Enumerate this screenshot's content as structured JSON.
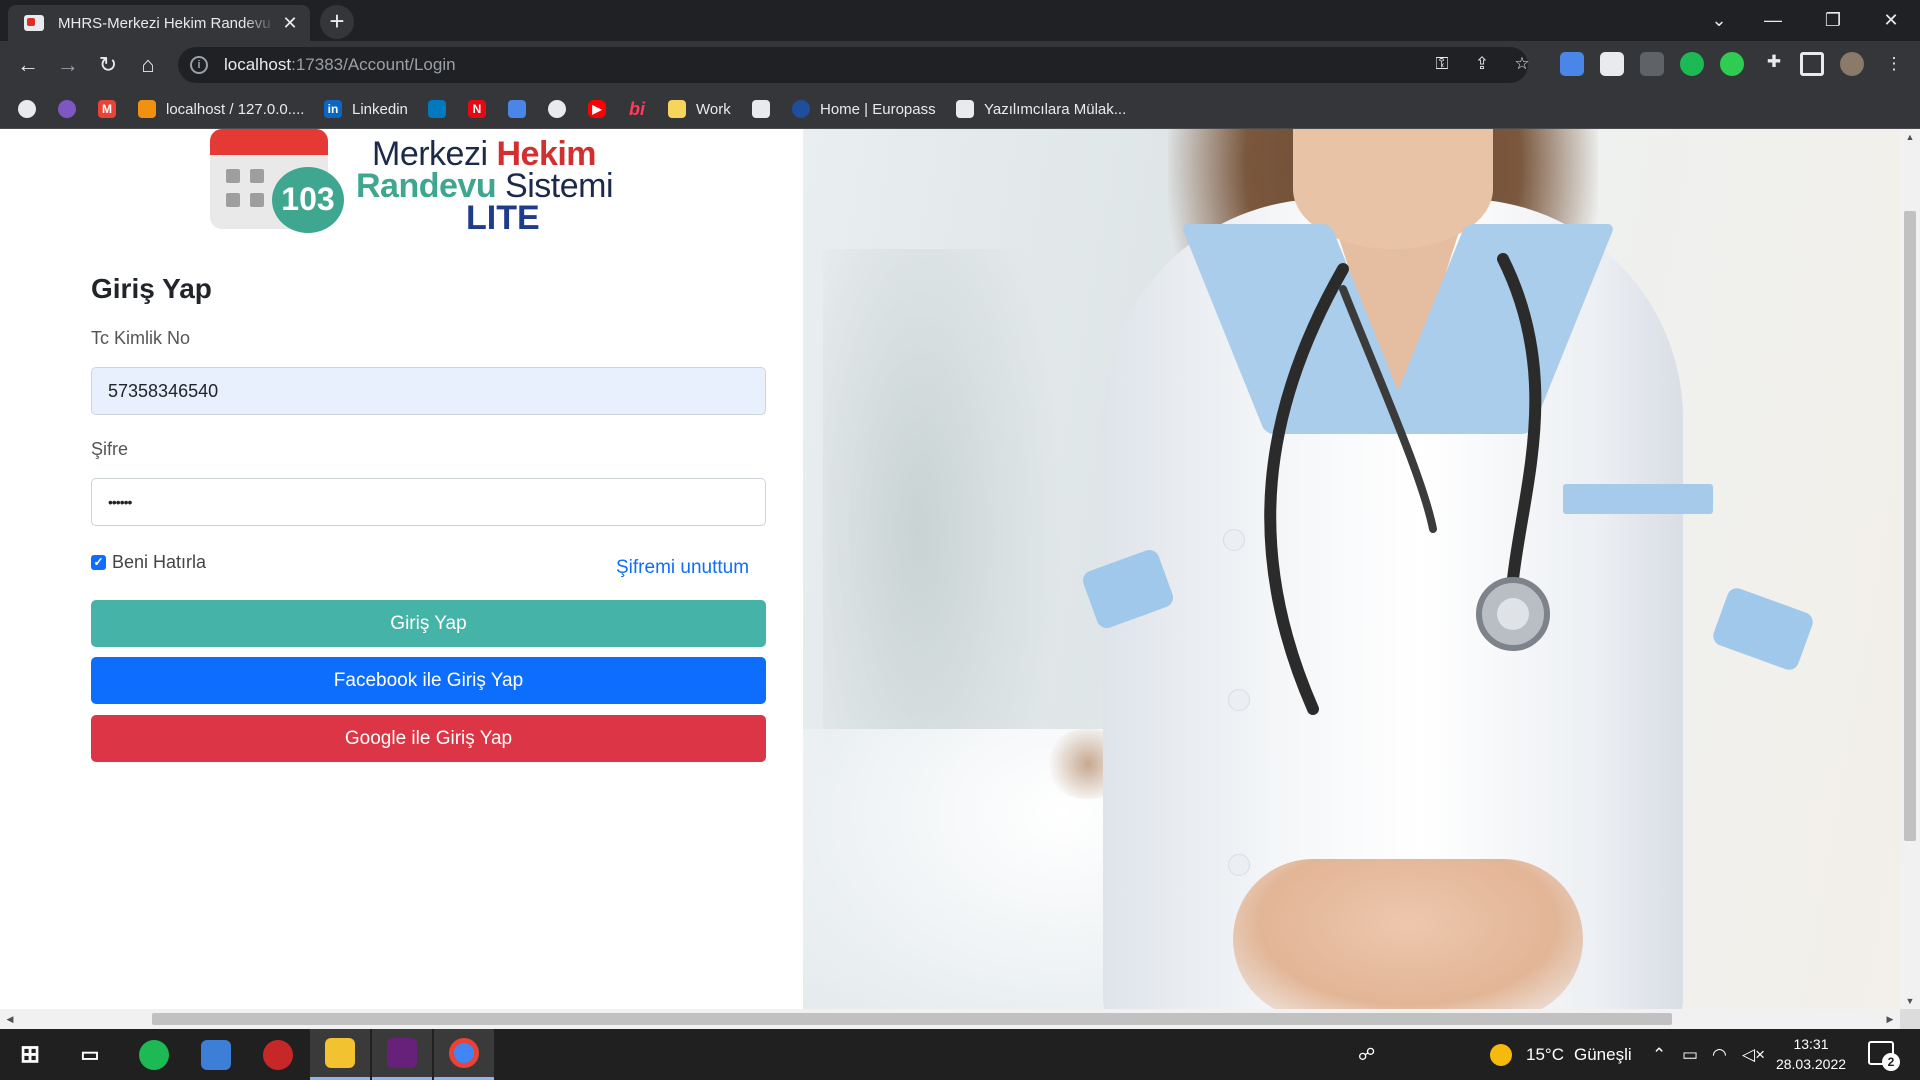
{
  "browser": {
    "tab_title": "MHRS-Merkezi Hekim Randevu Sistemi",
    "tab_close": "✕",
    "new_tab": "+",
    "url_host": "localhost",
    "url_rest": ":17383/Account/Login",
    "window_controls": [
      "⌄",
      "—",
      "❐",
      "✕"
    ]
  },
  "bookmarks": [
    {
      "label": "localhost / 127.0.0....",
      "icon": "phpmyadmin-icon"
    },
    {
      "label": "Linkedin",
      "icon": "linkedin-icon"
    },
    {
      "label": "Work",
      "icon": "folder-icon"
    },
    {
      "label": "Home | Europass",
      "icon": "europass-icon"
    },
    {
      "label": "Yazılımcılara Mülak...",
      "icon": "bookmark-page-icon"
    }
  ],
  "logo": {
    "word1": "Merkezi",
    "word2": "Hekim",
    "word3": "Randevu",
    "word4": "Sistemi",
    "word5": "LITE",
    "badge": "103"
  },
  "form": {
    "title": "Giriş Yap",
    "tc_label": "Tc Kimlik No",
    "tc_value": "57358346540",
    "password_label": "Şifre",
    "password_value": "••••••",
    "remember_label": "Beni Hatırla",
    "remember_checked": true,
    "forgot_link": "Şifremi unuttum",
    "login_button": "Giriş Yap",
    "facebook_button": "Facebook ile Giriş Yap",
    "google_button": "Google ile Giriş Yap"
  },
  "colors": {
    "login_button": "#45b3a8",
    "facebook_button": "#0d6efd",
    "google_button": "#dc3545",
    "link": "#0d6efd"
  },
  "taskbar": {
    "weather_temp": "15°C",
    "weather_text": "Güneşli",
    "time": "13:31",
    "date": "28.03.2022",
    "notifications": "2"
  }
}
